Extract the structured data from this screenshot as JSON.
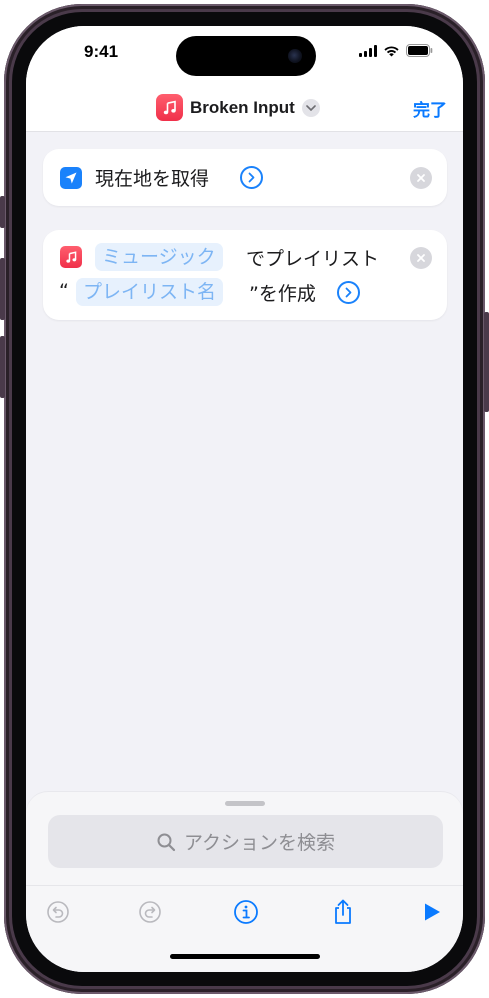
{
  "status_bar": {
    "time": "9:41"
  },
  "nav": {
    "title": "Broken Input",
    "done_label": "完了",
    "app_color": "#f0304a",
    "accent": "#0a7aff"
  },
  "actions": [
    {
      "icon": "location-arrow-icon",
      "text": "現在地を取得"
    },
    {
      "icon": "music-note-icon",
      "token_music": "ミュージック",
      "text_after_token": "でプレイリスト",
      "quote_open": "“",
      "token_playlist": "プレイリスト名",
      "text_end": "”を作成"
    }
  ],
  "search": {
    "placeholder": "アクションを検索"
  },
  "toolbar": {
    "items": [
      "undo-icon",
      "redo-icon",
      "info-icon",
      "share-icon",
      "play-icon"
    ]
  }
}
